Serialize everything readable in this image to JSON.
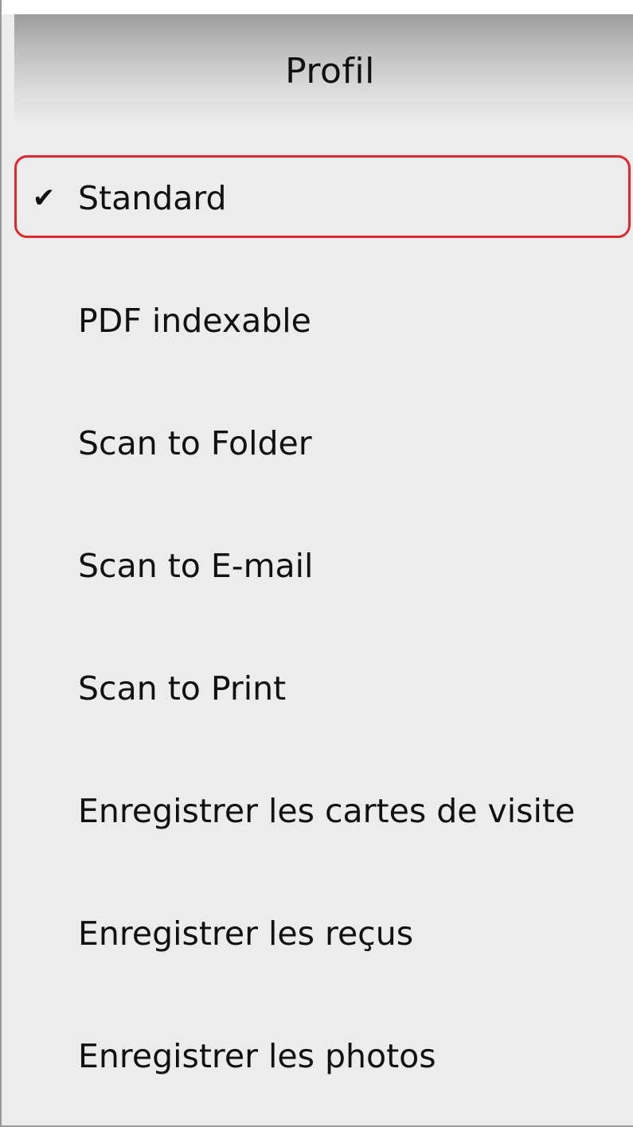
{
  "menu": {
    "header": "Profil",
    "items": [
      {
        "label": "Standard",
        "checked": true
      },
      {
        "label": "PDF indexable",
        "checked": false
      },
      {
        "label": "Scan to Folder",
        "checked": false
      },
      {
        "label": "Scan to E-mail",
        "checked": false
      },
      {
        "label": "Scan to Print",
        "checked": false
      },
      {
        "label": "Enregistrer les cartes de visite",
        "checked": false
      },
      {
        "label": "Enregistrer les reçus",
        "checked": false
      },
      {
        "label": "Enregistrer les photos",
        "checked": false
      }
    ],
    "check_glyph": "✔",
    "highlight_color": "#e0262f"
  }
}
